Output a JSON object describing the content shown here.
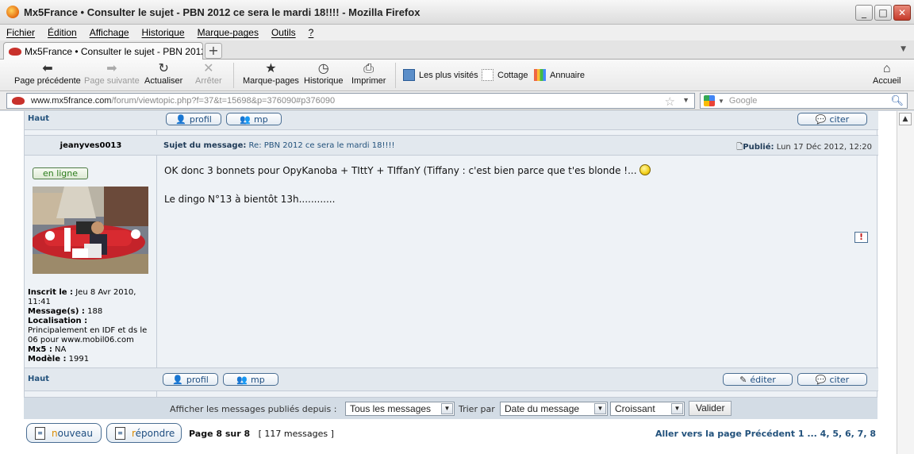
{
  "window": {
    "title": "Mx5France • Consulter le sujet - PBN 2012 ce sera le mardi 18!!!! - Mozilla Firefox"
  },
  "menu": [
    "Fichier",
    "Édition",
    "Affichage",
    "Historique",
    "Marque-pages",
    "Outils",
    "?"
  ],
  "tab": {
    "title": "Mx5France • Consulter le sujet - PBN 2012 c..."
  },
  "nav": {
    "back": "Page précédente",
    "forward": "Page suivante",
    "reload": "Actualiser",
    "stop": "Arrêter",
    "bookmarks": "Marque-pages",
    "history": "Historique",
    "print": "Imprimer",
    "home": "Accueil"
  },
  "bookmarks_bar": [
    "Les plus visités",
    "Cottage",
    "Annuaire"
  ],
  "address": {
    "domain": "www.mx5france.com",
    "path": "/forum/viewtopic.php?f=37&t=15698&p=376090#p376090"
  },
  "search": {
    "placeholder": "Google"
  },
  "forum": {
    "haut": "Haut",
    "profil": "profil",
    "mp": "mp",
    "citer": "citer",
    "editer": "éditer",
    "author": "jeanyves0013",
    "subject_label": "Sujet du message:",
    "subject": "Re: PBN 2012 ce sera le mardi 18!!!!",
    "published_label": "Publié:",
    "published": "Lun 17 Déc 2012, 12:20",
    "online": "en ligne",
    "profile": {
      "inscrit_label": "Inscrit le :",
      "inscrit": "Jeu 8 Avr 2010, 11:41",
      "messages_label": "Message(s) :",
      "messages": "188",
      "localisation_label": "Localisation :",
      "localisation": "Principalement en IDF et ds le 06 pour www.mobil06.com",
      "mx5_label": "Mx5 :",
      "mx5": "NA",
      "modele_label": "Modèle :",
      "modele": "1991"
    },
    "post_line1": "OK donc 3 bonnets pour OpyKanoba + TIttY + TIffanY (Tiffany : c'est bien parce que t'es blonde !...",
    "post_line2": "Le dingo N°13 à bientôt 13h............",
    "report": "!"
  },
  "filter": {
    "label": "Afficher les messages publiés depuis :",
    "since": "Tous les messages",
    "sort_label": "Trier par",
    "sort": "Date du message",
    "order": "Croissant",
    "submit": "Valider"
  },
  "footer": {
    "new_btn": "nouveau",
    "reply_btn": "répondre",
    "page_info": "Page 8 sur 8",
    "count": "[ 117 messages ]",
    "pagenav": "Aller vers la page Précédent  1 ... 4, 5, 6, 7, 8"
  }
}
